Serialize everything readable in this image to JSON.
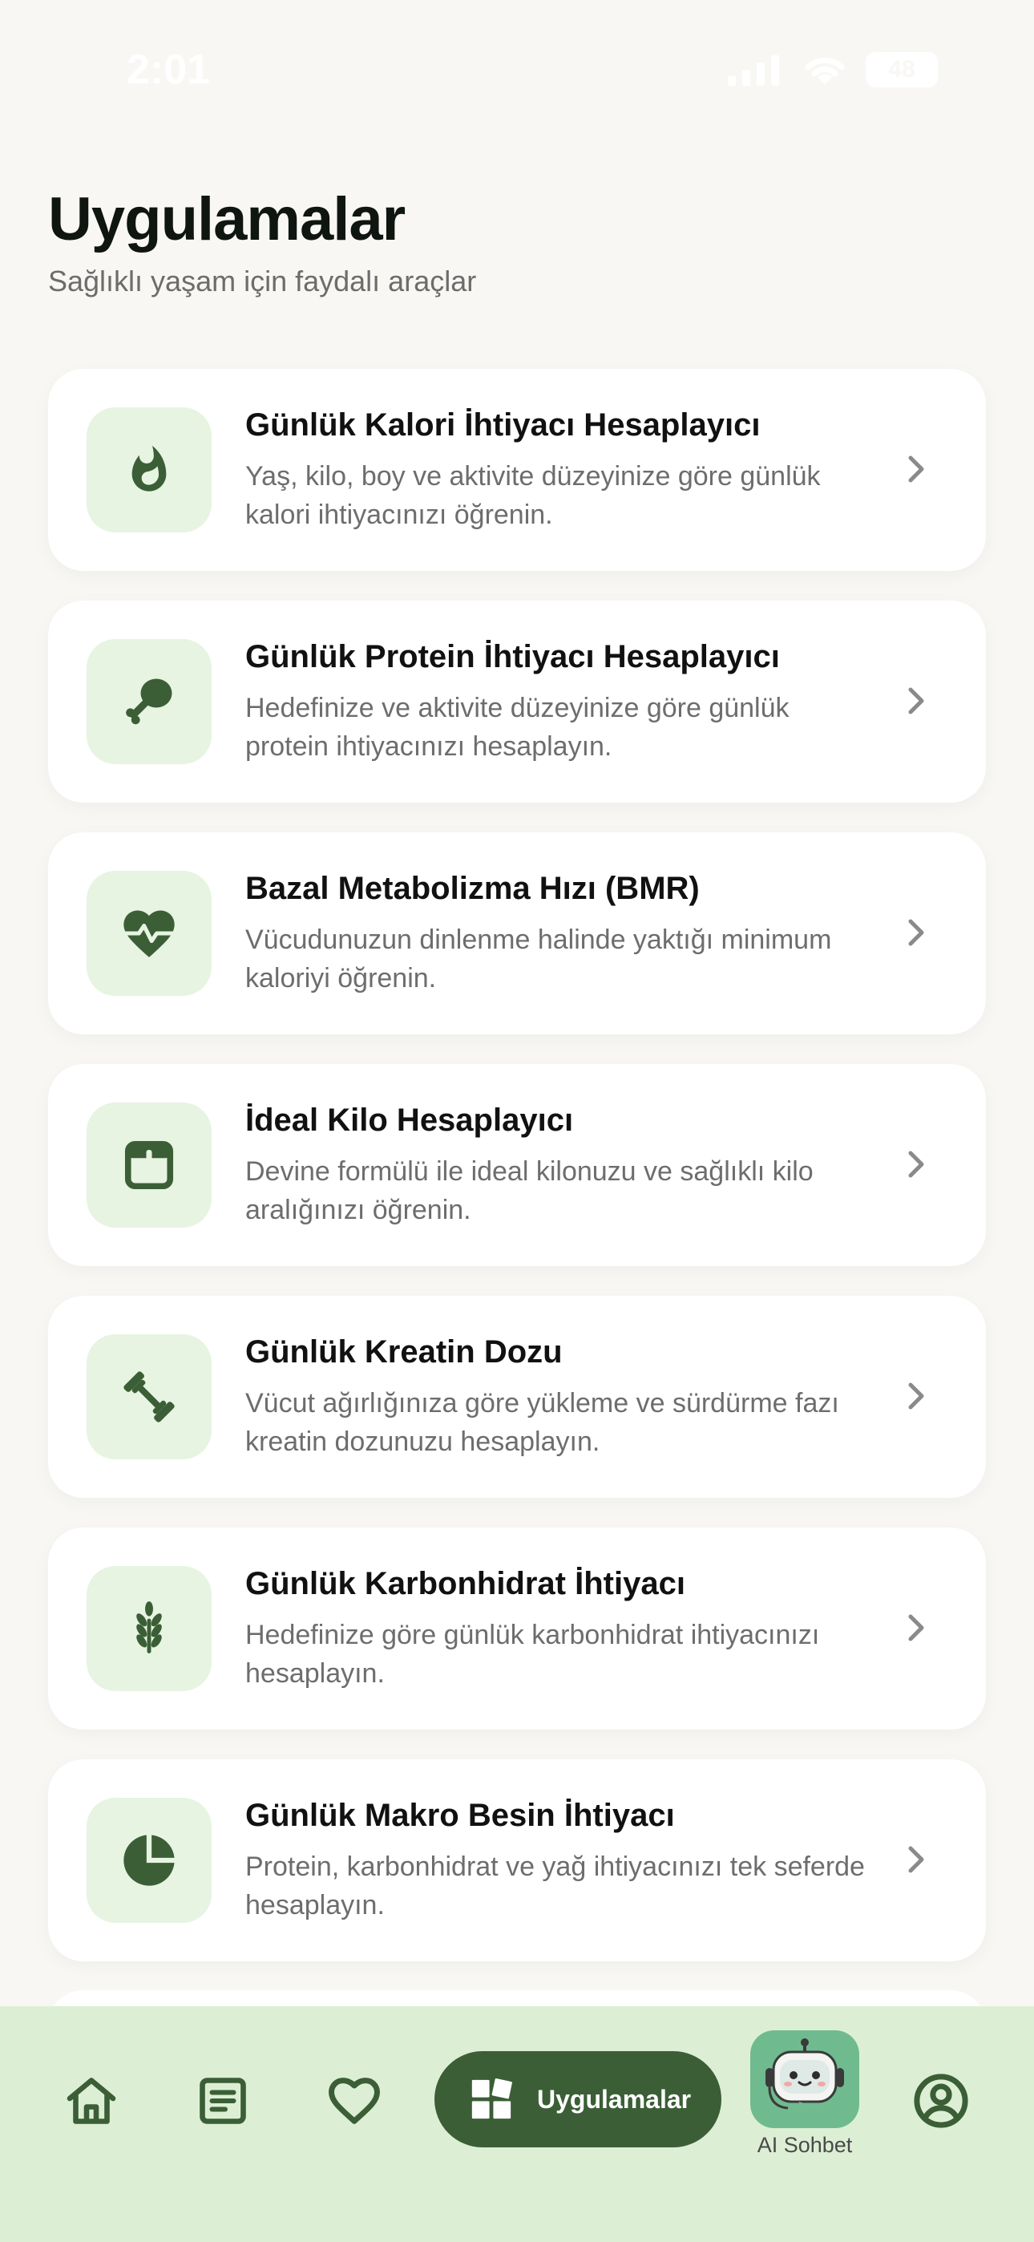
{
  "status_bar": {
    "time": "2:01",
    "battery": "48"
  },
  "header": {
    "title": "Uygulamalar",
    "subtitle": "Sağlıklı yaşam için faydalı araçlar"
  },
  "cards": [
    {
      "icon": "flame-icon",
      "title": "Günlük Kalori İhtiyacı Hesaplayıcı",
      "description": "Yaş, kilo, boy ve aktivite düzeyinize göre günlük kalori ihtiyacınızı öğrenin."
    },
    {
      "icon": "drumstick-icon",
      "title": "Günlük Protein İhtiyacı Hesaplayıcı",
      "description": "Hedefinize ve aktivite düzeyinize göre günlük protein ihtiyacınızı hesaplayın."
    },
    {
      "icon": "heart-pulse-icon",
      "title": "Bazal Metabolizma Hızı (BMR)",
      "description": "Vücudunuzun dinlenme halinde yaktığı minimum kaloriyi öğrenin."
    },
    {
      "icon": "scale-icon",
      "title": "İdeal Kilo Hesaplayıcı",
      "description": "Devine formülü ile ideal kilonuzu ve sağlıklı kilo aralığınızı öğrenin."
    },
    {
      "icon": "dumbbell-icon",
      "title": "Günlük Kreatin Dozu",
      "description": "Vücut ağırlığınıza göre yükleme ve sürdürme fazı kreatin dozunuzu hesaplayın."
    },
    {
      "icon": "wheat-icon",
      "title": "Günlük Karbonhidrat İhtiyacı",
      "description": "Hedefinize göre günlük karbonhidrat ihtiyacınızı hesaplayın."
    },
    {
      "icon": "pie-chart-icon",
      "title": "Günlük Makro Besin İhtiyacı",
      "description": "Protein, karbonhidrat ve yağ ihtiyacınızı tek seferde hesaplayın."
    }
  ],
  "bottom_nav": {
    "items": [
      "home-icon",
      "article-icon",
      "heart-icon",
      "apps-grid-icon",
      "robot-icon",
      "profile-icon"
    ],
    "active_label": "Uygulamalar",
    "ai_label": "AI Sohbet"
  },
  "colors": {
    "accent": "#3b5e36",
    "icon_bg": "#e6f4e1",
    "nav_bg": "#dcefd4",
    "ai_bg": "#6fbb8f"
  }
}
